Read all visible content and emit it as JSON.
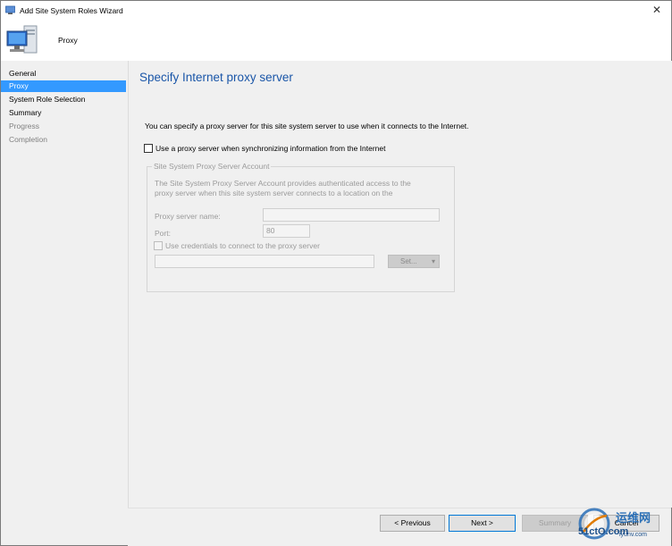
{
  "window": {
    "title": "Add Site System Roles Wizard",
    "close_glyph": "✕"
  },
  "header": {
    "title": "Proxy",
    "icon": "computer-icon"
  },
  "sidebar": {
    "items": [
      {
        "label": "General",
        "state": "normal"
      },
      {
        "label": "Proxy",
        "state": "active"
      },
      {
        "label": "System Role Selection",
        "state": "normal"
      },
      {
        "label": "Summary",
        "state": "normal"
      },
      {
        "label": "Progress",
        "state": "dim"
      },
      {
        "label": "Completion",
        "state": "dim"
      }
    ]
  },
  "main": {
    "page_title": "Specify Internet proxy server",
    "description": "You can specify a proxy server for this site system server to use when it connects to the Internet.",
    "use_proxy_label": "Use a proxy server when synchronizing information from the Internet",
    "use_proxy_checked": false,
    "group": {
      "legend": "Site System Proxy Server Account",
      "description_line1": "The Site System Proxy Server Account provides authenticated access to the",
      "description_line2": "proxy server when this site system server connects to a location on the",
      "proxy_name_label": "Proxy server name:",
      "proxy_name_value": "",
      "port_label": "Port:",
      "port_value": "80",
      "credentials_label": "Use credentials to connect to the proxy server",
      "credentials_checked": false,
      "account_value": "",
      "set_button": "Set...",
      "set_arrow": "▾"
    }
  },
  "footer": {
    "previous": "< Previous",
    "next": "Next >",
    "summary": "Summary",
    "cancel": "Cancel"
  },
  "watermark": {
    "site_name": "运维网",
    "domain": "51ctO.com",
    "sub": "iyunv.com"
  },
  "colors": {
    "accent": "#3399ff",
    "title_blue": "#1a56a8",
    "primary_border": "#0078d7"
  }
}
